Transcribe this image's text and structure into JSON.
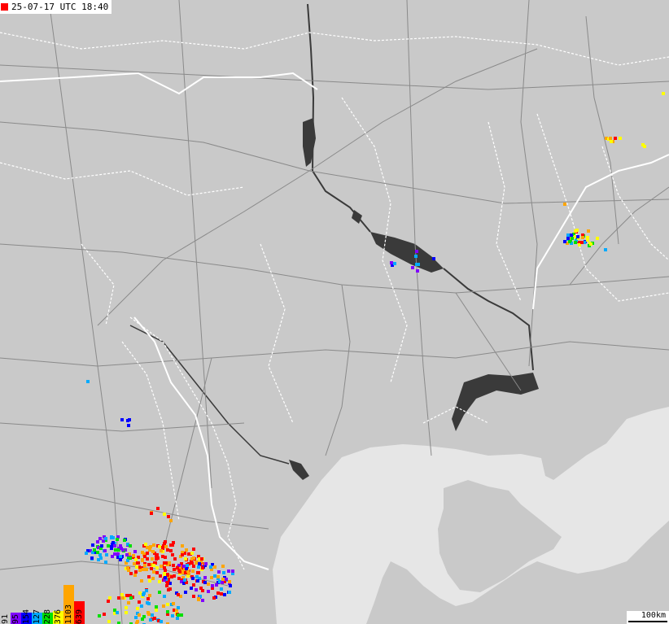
{
  "timestamp": "25-07-17 UTC 18:40",
  "scale_label": "100km",
  "colors": {
    "land": "#c9c9c9",
    "sea": "#e6e6e6",
    "water": "#3a3a3a",
    "border": "#ffffff",
    "road": "#808080",
    "timestamp_marker": "#ff0000"
  },
  "legend": [
    {
      "label": "91",
      "color": "#c8c8c8",
      "count": 91
    },
    {
      "label": "95",
      "color": "#8000ff",
      "count": 95
    },
    {
      "label": "154",
      "color": "#0000ff",
      "count": 154
    },
    {
      "label": "127",
      "color": "#00aaff",
      "count": 127
    },
    {
      "label": "228",
      "color": "#00e000",
      "count": 228
    },
    {
      "label": "376",
      "color": "#ffff00",
      "count": 376
    },
    {
      "label": "1103",
      "color": "#ffa500",
      "count": 1103
    },
    {
      "label": "639",
      "color": "#ff0000",
      "count": 639
    }
  ]
}
